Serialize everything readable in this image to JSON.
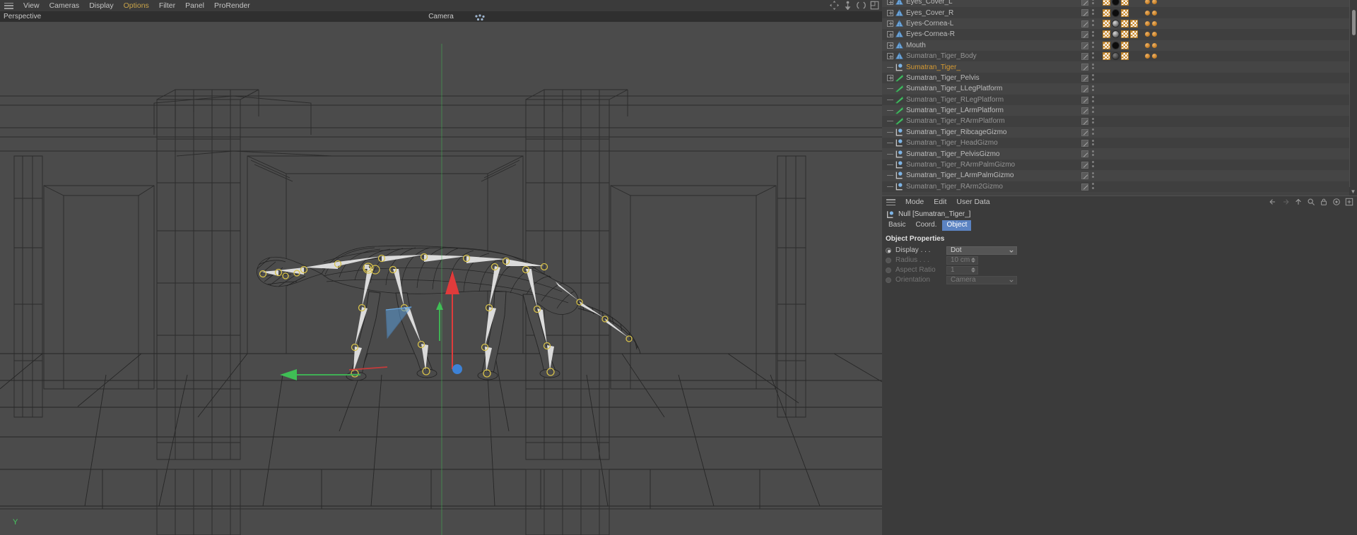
{
  "viewport": {
    "menu_items": [
      "View",
      "Cameras",
      "Display",
      "Options",
      "Filter",
      "Panel",
      "ProRender"
    ],
    "active_menu": "Options",
    "perspective_label": "Perspective",
    "camera_label": "Camera",
    "axis_label": "Y",
    "nav_icons": [
      "pan-icon",
      "dolly-icon",
      "rotate-icon",
      "maximize-icon"
    ],
    "camera_icon": "camera-dots-icon"
  },
  "object_manager": {
    "rows": [
      {
        "name": "Eyes_Cover_L",
        "icon": "polygon-object-icon",
        "expander": true,
        "indent": 1,
        "selected": false,
        "dim": false,
        "tags": [
          "checker",
          "black-material",
          "checker"
        ],
        "spheres": 2
      },
      {
        "name": "Eyes_Cover_R",
        "icon": "polygon-object-icon",
        "expander": true,
        "indent": 1,
        "selected": false,
        "dim": false,
        "tags": [
          "checker",
          "black-material",
          "checker"
        ],
        "spheres": 2
      },
      {
        "name": "Eyes-Cornea-L",
        "icon": "polygon-object-icon",
        "expander": true,
        "indent": 1,
        "selected": false,
        "dim": false,
        "tags": [
          "checker",
          "grey-material",
          "checker",
          "checker"
        ],
        "spheres": 2
      },
      {
        "name": "Eyes-Cornea-R",
        "icon": "polygon-object-icon",
        "expander": true,
        "indent": 1,
        "selected": false,
        "dim": false,
        "tags": [
          "checker",
          "grey-material",
          "checker",
          "checker"
        ],
        "spheres": 2
      },
      {
        "name": "Mouth",
        "icon": "polygon-object-icon",
        "expander": true,
        "indent": 1,
        "selected": false,
        "dim": false,
        "tags": [
          "checker",
          "black-material",
          "checker"
        ],
        "spheres": 2
      },
      {
        "name": "Sumatran_Tiger_Body",
        "icon": "polygon-object-icon",
        "expander": true,
        "indent": 1,
        "selected": false,
        "dim": true,
        "tags": [
          "checker",
          "dark-material",
          "checker"
        ],
        "spheres": 2
      },
      {
        "name": "Sumatran_Tiger_",
        "icon": "null-object-icon",
        "expander": false,
        "indent": 0,
        "selected": true,
        "dim": false,
        "tags": [],
        "spheres": 0
      },
      {
        "name": "Sumatran_Tiger_Pelvis",
        "icon": "joint-object-icon",
        "expander": true,
        "indent": 1,
        "selected": false,
        "dim": false,
        "tags": [],
        "spheres": 0
      },
      {
        "name": "Sumatran_Tiger_LLegPlatform",
        "icon": "joint-object-icon",
        "expander": false,
        "indent": 1,
        "selected": false,
        "dim": false,
        "tags": [],
        "spheres": 0
      },
      {
        "name": "Sumatran_Tiger_RLegPlatform",
        "icon": "joint-object-icon",
        "expander": false,
        "indent": 1,
        "selected": false,
        "dim": true,
        "tags": [],
        "spheres": 0
      },
      {
        "name": "Sumatran_Tiger_LArmPlatform",
        "icon": "joint-object-icon",
        "expander": false,
        "indent": 1,
        "selected": false,
        "dim": false,
        "tags": [],
        "spheres": 0
      },
      {
        "name": "Sumatran_Tiger_RArmPlatform",
        "icon": "joint-object-icon",
        "expander": false,
        "indent": 1,
        "selected": false,
        "dim": true,
        "tags": [],
        "spheres": 0
      },
      {
        "name": "Sumatran_Tiger_RibcageGizmo",
        "icon": "null-object-icon",
        "expander": false,
        "indent": 1,
        "selected": false,
        "dim": false,
        "tags": [],
        "spheres": 0
      },
      {
        "name": "Sumatran_Tiger_HeadGizmo",
        "icon": "null-object-icon",
        "expander": false,
        "indent": 1,
        "selected": false,
        "dim": true,
        "tags": [],
        "spheres": 0
      },
      {
        "name": "Sumatran_Tiger_PelvisGizmo",
        "icon": "null-object-icon",
        "expander": false,
        "indent": 1,
        "selected": false,
        "dim": false,
        "tags": [],
        "spheres": 0
      },
      {
        "name": "Sumatran_Tiger_RArmPalmGizmo",
        "icon": "null-object-icon",
        "expander": false,
        "indent": 1,
        "selected": false,
        "dim": true,
        "tags": [],
        "spheres": 0
      },
      {
        "name": "Sumatran_Tiger_LArmPalmGizmo",
        "icon": "null-object-icon",
        "expander": false,
        "indent": 1,
        "selected": false,
        "dim": false,
        "tags": [],
        "spheres": 0
      },
      {
        "name": "Sumatran_Tiger_RArm2Gizmo",
        "icon": "null-object-icon",
        "expander": false,
        "indent": 1,
        "selected": false,
        "dim": true,
        "tags": [],
        "spheres": 0
      }
    ]
  },
  "attribute_manager": {
    "menu_items": [
      "Mode",
      "Edit",
      "User Data"
    ],
    "toolbar_icons": [
      "back-arrow-icon",
      "forward-arrow-icon",
      "up-arrow-icon",
      "search-icon",
      "lock-icon",
      "target-icon",
      "new-panel-icon"
    ],
    "object_line": "Null [Sumatran_Tiger_]",
    "tabs": [
      {
        "label": "Basic",
        "active": false
      },
      {
        "label": "Coord.",
        "active": false
      },
      {
        "label": "Object",
        "active": true
      }
    ],
    "section_title": "Object Properties",
    "properties": [
      {
        "label": "Display . . .",
        "type": "select",
        "value": "Dot",
        "enabled": true
      },
      {
        "label": "Radius . . .",
        "type": "number",
        "value": "10 cm",
        "enabled": false
      },
      {
        "label": "Aspect Ratio",
        "type": "number",
        "value": "1",
        "enabled": false
      },
      {
        "label": "Orientation",
        "type": "select",
        "value": "Camera",
        "enabled": false
      }
    ]
  },
  "colors": {
    "accent_selected": "#d79b32",
    "tab_active": "#5b83c2",
    "menu_active": "#c8a349",
    "axis_y": "#45c95f",
    "axis_x": "#c84040",
    "axis_z": "#3d82d6",
    "viewport_bg": "#4b4b4b",
    "panel_bg": "#3b3b3b"
  }
}
